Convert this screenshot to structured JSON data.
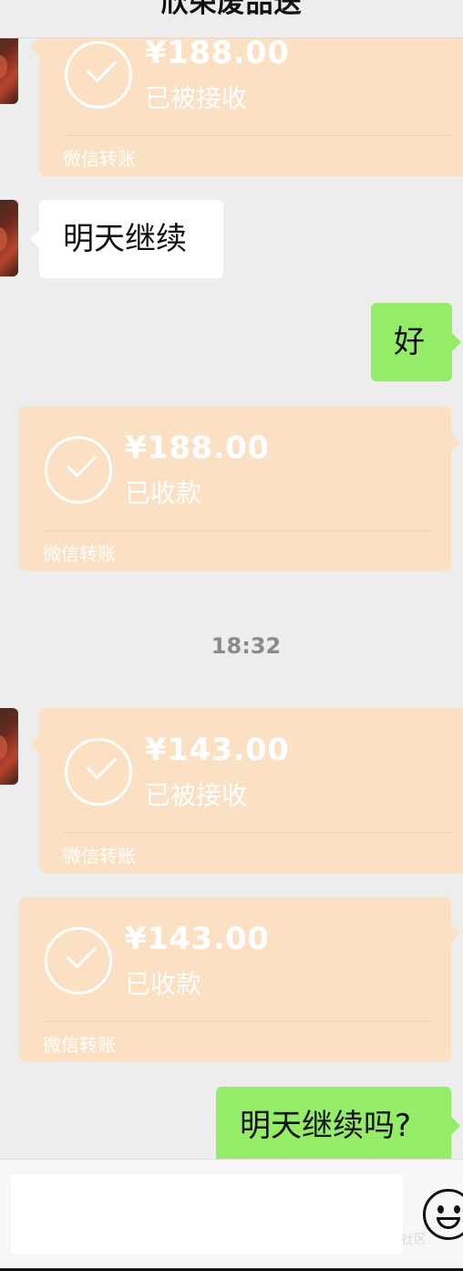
{
  "header": {
    "title": "欣荣废品送"
  },
  "messages": {
    "t1": {
      "amount": "¥188.00",
      "status": "已被接收",
      "label": "微信转账"
    },
    "m1": {
      "text": "明天继续"
    },
    "m2": {
      "text": "好"
    },
    "t2": {
      "amount": "¥188.00",
      "status": "已收款",
      "label": "微信转账"
    },
    "time": "18:32",
    "t3": {
      "amount": "¥143.00",
      "status": "已被接收",
      "label": "微信转账"
    },
    "t4": {
      "amount": "¥143.00",
      "status": "已收款",
      "label": "微信转账"
    },
    "m3": {
      "text": "明天继续吗?"
    }
  },
  "input": {
    "emoji_icon": "smiley-icon"
  },
  "watermark": "社区",
  "colors": {
    "transfer": "#fbe0c3",
    "sent": "#95ec69",
    "received": "#ffffff",
    "background": "#ededed"
  }
}
